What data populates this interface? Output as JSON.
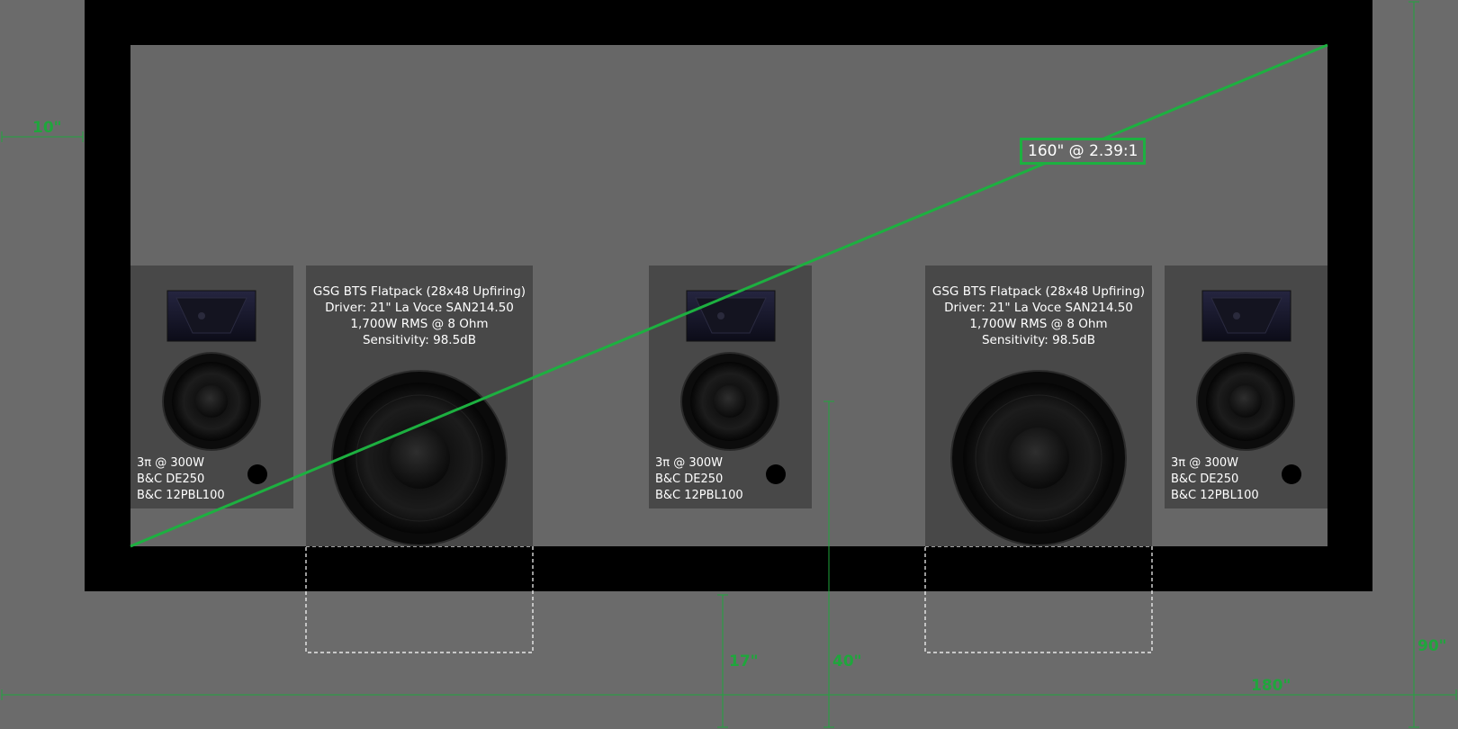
{
  "dimensions": {
    "side_margin": "10\"",
    "width": "180\"",
    "height": "90\"",
    "screen_bottom": "17\"",
    "speaker_height": "40\""
  },
  "screen": {
    "label": "160\" @ 2.39:1"
  },
  "speakers": [
    {
      "id": "left",
      "lines": [
        "3π @ 300W",
        "B&C DE250",
        "B&C 12PBL100"
      ]
    },
    {
      "id": "center",
      "lines": [
        "3π @ 300W",
        "B&C DE250",
        "B&C 12PBL100"
      ]
    },
    {
      "id": "right",
      "lines": [
        "3π @ 300W",
        "B&C DE250",
        "B&C 12PBL100"
      ]
    }
  ],
  "subwoofers": [
    {
      "id": "left",
      "lines": [
        "GSG BTS Flatpack (28x48 Upfiring)",
        "Driver: 21\" La Voce SAN214.50",
        "1,700W RMS @ 8 Ohm",
        "Sensitivity: 98.5dB"
      ]
    },
    {
      "id": "right",
      "lines": [
        "GSG BTS Flatpack (28x48 Upfiring)",
        "Driver: 21\" La Voce SAN214.50",
        "1,700W RMS @ 8 Ohm",
        "Sensitivity: 98.5dB"
      ]
    }
  ],
  "colors": {
    "wall": "#6b6b6b",
    "frame": "#000000",
    "screen": "#676767",
    "panel": "#484848",
    "dimension_green": "#1fa63c",
    "diagonal_green": "#1db040"
  }
}
